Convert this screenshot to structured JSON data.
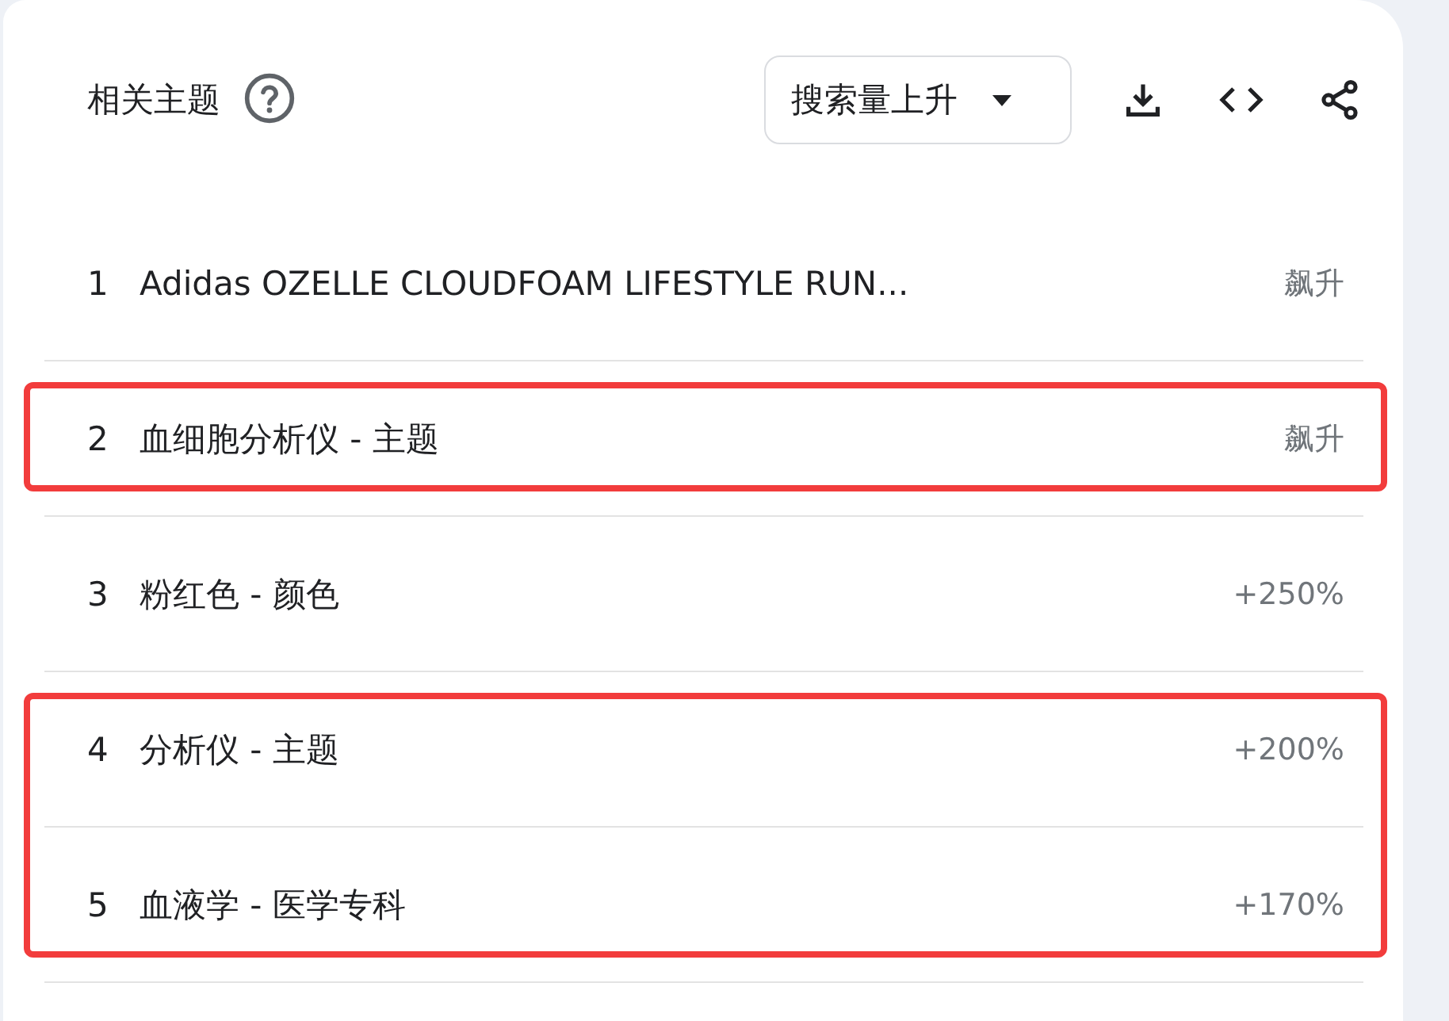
{
  "header": {
    "title": "相关主题",
    "dropdown": {
      "value": "搜索量上升"
    }
  },
  "sections": [
    {
      "highlighted": false,
      "rows": [
        {
          "rank": "1",
          "label": "Adidas OZELLE CLOUDFOAM LIFESTYLE RUN...",
          "value": "飙升"
        }
      ]
    },
    {
      "highlighted": true,
      "rows": [
        {
          "rank": "2",
          "label": "血细胞分析仪 - 主题",
          "value": "飙升"
        }
      ]
    },
    {
      "highlighted": false,
      "rows": [
        {
          "rank": "3",
          "label": "粉红色 - 颜色",
          "value": "+250%"
        }
      ]
    },
    {
      "highlighted": true,
      "rows": [
        {
          "rank": "4",
          "label": "分析仪 - 主题",
          "value": "+200%"
        },
        {
          "rank": "5",
          "label": "血液学 - 医学专科",
          "value": "+170%"
        }
      ]
    }
  ]
}
